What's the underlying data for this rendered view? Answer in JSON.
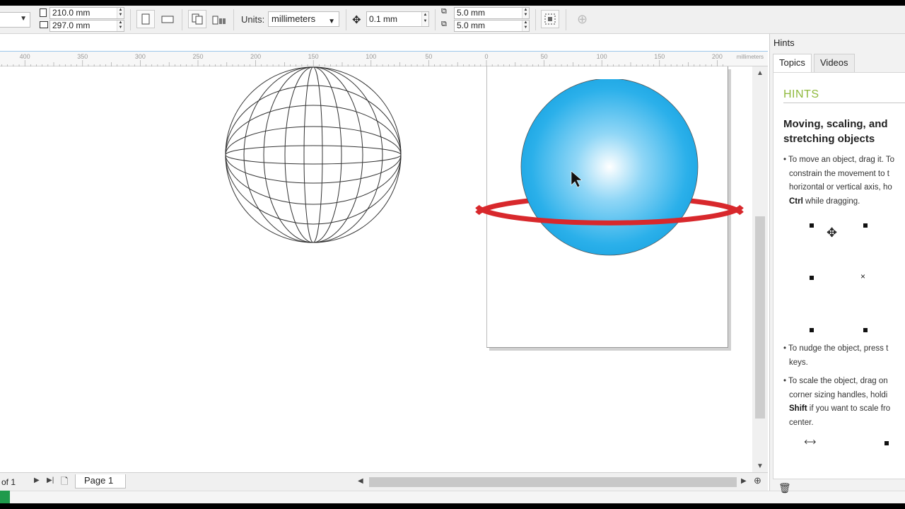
{
  "propbar": {
    "width_value": "210.0 mm",
    "height_value": "297.0 mm",
    "units_label": "Units:",
    "units_value": "millimeters",
    "nudge_value": "0.1 mm",
    "dup_x_value": "5.0 mm",
    "dup_y_value": "5.0 mm"
  },
  "ruler": {
    "ticks": [
      "400",
      "350",
      "300",
      "250",
      "200",
      "150",
      "100",
      "50",
      "0",
      "50",
      "100",
      "150",
      "200"
    ],
    "unit_label": "millimeters"
  },
  "bottombar": {
    "page_count": "of 1",
    "page_tab": "Page 1"
  },
  "hints": {
    "panel_title": "Hints",
    "tabs": [
      "Topics",
      "Videos"
    ],
    "section_title": "HINTS",
    "heading_line1": "Moving, scaling, and",
    "heading_line2": "stretching objects",
    "p1": [
      "• To move an object, drag it. To",
      "constrain the movement to t",
      "horizontal or vertical axis, ho"
    ],
    "p1_ctrl": "Ctrl",
    "p1_tail": " while dragging.",
    "p2": [
      "• To nudge the object, press t",
      "keys."
    ],
    "p3": [
      "• To scale the object, drag on",
      "corner sizing handles, holdi"
    ],
    "p3_shift": "Shift",
    "p3_tail": " if you want to scale fro",
    "p3_end": "center."
  },
  "colors": {
    "sphere_top": "#1aa8e8",
    "sphere_highlight": "#ffffff",
    "ring": "#d8282c",
    "hint_green": "#8fb93c",
    "status_green": "#1f9a4c"
  }
}
